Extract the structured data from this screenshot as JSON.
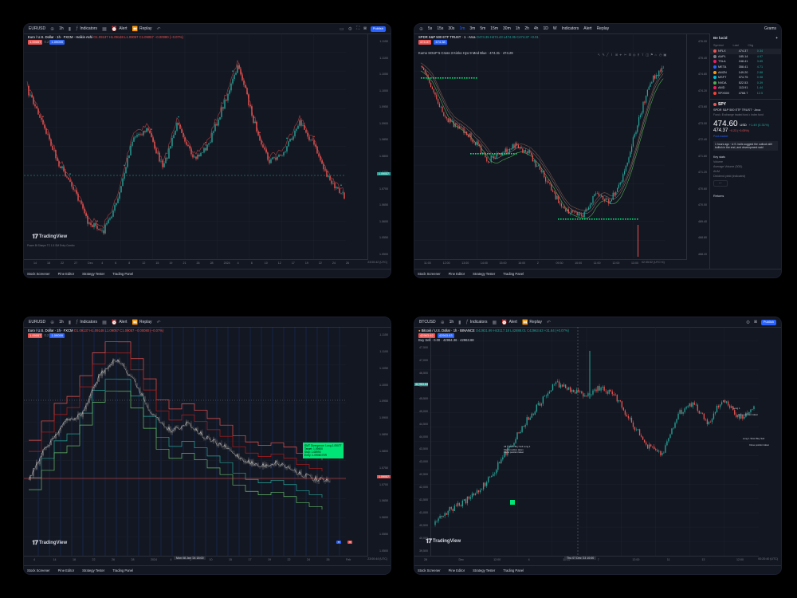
{
  "panel1": {
    "toolbar": {
      "symbol": "EURUSD",
      "interval": "1h",
      "indicators": "Indicators",
      "alert": "Alert",
      "replay": "Replay",
      "publish": "Publish"
    },
    "legend": {
      "title": "Euro / U.S. Dollar · 1h · FXCM · Heikin Ashi",
      "ohlc": "O1.09137 H1.09148 L1.09057 C1.09057 −0.00080 (−0.07%)",
      "sell": "1.09057",
      "spread": "0.2",
      "buy": "1.09059"
    },
    "price_labels": [
      "1.1150",
      "1.1100",
      "1.1050",
      "1.1000",
      "1.0950",
      "1.0900",
      "1.0850",
      "1.0800",
      "1.0750",
      "1.0700",
      "1.0650",
      "1.0600",
      "1.0550",
      "1.0500"
    ],
    "current_price": "1.09057",
    "time_labels": [
      "14",
      "18",
      "22",
      "27",
      "Dec",
      "4",
      "6",
      "8",
      "12",
      "15",
      "19",
      "21",
      "26",
      "28",
      "2024",
      "4",
      "8",
      "10",
      "12",
      "17",
      "19",
      "22",
      "24",
      "26"
    ],
    "range": [
      "1D",
      "5D",
      "1M",
      "3M",
      "6M",
      "YTD",
      "1Y",
      "5Y",
      "All"
    ],
    "status": "Power Bi Sharpe TC 1.5 SM Entry Combo",
    "clock": "23:00:42 (UTC)",
    "footer": [
      "Stock Screener",
      "Pine Editor",
      "Strategy Tester",
      "Trading Panel"
    ],
    "brand": "TradingView"
  },
  "panel2": {
    "toolbar": {
      "intervals": [
        "5s",
        "15s",
        "30s",
        "1m",
        "3m",
        "5m",
        "15m",
        "30m",
        "1h",
        "2h",
        "4h",
        "1D",
        "W"
      ],
      "indicators": "Indicators",
      "alert": "Alert",
      "replay": "Replay",
      "layout": "Grams"
    },
    "legend": {
      "title": "SPDR S&P 500 ETF TRUST · 1 · Arca",
      "ohlc": "O474.35 H474.43 L474.35 C474.37 +0.01",
      "sell": "474.37",
      "buy": "474.38"
    },
    "indicator_line": "Kumo SOUP 5 Cross 3 Kinko Hyo 9 Med Blue · 474.31 · 474.29",
    "price_labels": [
      "476.00",
      "475.40",
      "474.80",
      "474.20",
      "473.60",
      "473.00",
      "472.40",
      "471.80",
      "471.20",
      "470.60",
      "470.00",
      "469.40",
      "468.80",
      "468.20"
    ],
    "time_labels": [
      "11:00",
      "12:00",
      "13:00",
      "14:00",
      "15:00",
      "16:00",
      "2",
      "09:30",
      "10:00",
      "11:00",
      "12:00",
      "13:00"
    ],
    "range": [
      "1D",
      "5D",
      "1M",
      "3M",
      "6M",
      "YTD",
      "1Y",
      "5Y",
      "All"
    ],
    "clock": "02:35:52 (UTC+4)",
    "footer": [
      "Stock Screener",
      "Pine Editor",
      "Strategy Tester",
      "Trading Panel"
    ],
    "watchlist": {
      "title": "Be lucid",
      "columns": [
        "Symbol",
        "Last",
        "Chg"
      ],
      "rows": [
        {
          "sym": "NFLX",
          "last": "474.37",
          "chg": "0.34",
          "dot": "#ef5350",
          "dir": "up"
        },
        {
          "sym": "AAPL",
          "last": "185.14",
          "chg": "4.97",
          "dot": "#787b86",
          "dir": "up"
        },
        {
          "sym": "TSLA",
          "last": "248.41",
          "chg": "3.85",
          "dot": "#e91e63",
          "dir": "up"
        },
        {
          "sym": "META",
          "last": "358.41",
          "chg": "4.71",
          "dot": "#2962ff",
          "dir": "up"
        },
        {
          "sym": "AMZN",
          "last": "149.20",
          "chg": "2.88",
          "dot": "#ff9800",
          "dir": "up"
        },
        {
          "sym": "MSFT",
          "last": "374.75",
          "chg": "0.98",
          "dot": "#00bcd4",
          "dir": "up"
        },
        {
          "sym": "NVDA",
          "last": "522.53",
          "chg": "0.39",
          "dot": "#4caf50",
          "dir": "up"
        },
        {
          "sym": "AMD",
          "last": "113.91",
          "chg": "1.44",
          "dot": "#e91e63",
          "dir": "up"
        },
        {
          "sym": "SPX500",
          "last": "4768.7",
          "chg": "12.5",
          "dot": "#f44336",
          "dir": "up"
        }
      ],
      "detail": {
        "symbol": "SPY",
        "name": "SPDR S&P 500 ETF TRUST · Arca",
        "sub": "Fund • Exchange traded fund • Index fund",
        "price": "474.60",
        "price_unit": "USD",
        "change": "+1.49 (0.31%)",
        "post_price": "474.37",
        "post_change": "−0.23 (−0.05%)",
        "post_label": "Post-market",
        "news": "1 hours ago · U.S. bulls suggest the outlook still bullish in the end, and development said",
        "see_more": "Key stats",
        "stats": [
          [
            "Volume",
            ""
          ],
          [
            "Average Volume (30D)",
            ""
          ],
          [
            "AUM",
            ""
          ],
          [
            "Dividend yield (indicated)",
            ""
          ]
        ],
        "footer": "Returns"
      }
    }
  },
  "panel3": {
    "toolbar": {
      "symbol": "EURUSD",
      "interval": "1h",
      "indicators": "Indicators",
      "alert": "Alert",
      "replay": "Replay"
    },
    "legend": {
      "title": "Euro / U.S. Dollar · 1h · FXCM",
      "ohlc": "O1.09137 H1.09148 L1.09057 C1.09057 −0.00080 (−0.07%)",
      "sell": "1.09057",
      "spread": "0.2",
      "buy": "1.09059"
    },
    "price_labels": [
      "1.1150",
      "1.1100",
      "1.1050",
      "1.1000",
      "1.0950",
      "1.0900",
      "1.0850",
      "1.0800",
      "1.0750",
      "1.0700",
      "1.0650",
      "1.0600",
      "1.0550",
      "1.0500"
    ],
    "current_price": "1.09057",
    "callout": [
      "SMT Divergence: Long 1.09077",
      "Target: 1.09400",
      "Stop: 1.08990",
      "Entry: 1.09060 R/R"
    ],
    "date_chip": "Mon 08 Jan '24  18:00",
    "time_labels": [
      "4",
      "14",
      "18",
      "22",
      "26",
      "28",
      "2024",
      "4",
      "8",
      "10",
      "15",
      "17",
      "19",
      "22",
      "24",
      "26",
      "Feb"
    ],
    "range": [
      "1D",
      "5D",
      "1M",
      "3M",
      "6M",
      "YTD",
      "1Y",
      "5Y",
      "All"
    ],
    "clock": "23:00:44 (UTC)",
    "footer": [
      "Stock Screener",
      "Pine Editor",
      "Strategy Tester",
      "Trading Panel"
    ],
    "brand": "TradingView"
  },
  "panel4": {
    "toolbar": {
      "symbol": "BTCUSD",
      "interval": "1h",
      "indicators": "Indicators",
      "alert": "Alert",
      "replay": "Replay",
      "publish": "Publish"
    },
    "legend": {
      "title": "Bitcoin / U.S. Dollar · 1h · BINANCE",
      "ohlc": "O42931.99 H43117.18 L42888.01 C42963.63 +31.64 (+0.07%)",
      "sell": "42963.62",
      "buy": "42963.63",
      "indicator": "Buy Sell · 0.00 · 42964.36 · 42963.68"
    },
    "price_labels": [
      "48,000",
      "47,500",
      "47,000",
      "46,500",
      "46,000",
      "45,500",
      "45,000",
      "44,500",
      "44,000",
      "43,500",
      "43,000",
      "42,500",
      "42,000",
      "41,500",
      "41,000",
      "40,500",
      "40,000",
      "39,500"
    ],
    "current_price": "42,963.63",
    "annotations": [
      "All 7 Short Buy Sell Long 1 Short position taken",
      "Close position taken",
      "Long 1",
      "Close position taken",
      "Long 1 Short Buy Sell",
      "Close position taken"
    ],
    "date_chip": "Thu 07 Dec '23  10:00",
    "time_labels": [
      "28",
      "Dec",
      "12:00",
      "4",
      "12:00",
      "7",
      "12:00",
      "11",
      "13",
      "12:00"
    ],
    "range": [
      "1D",
      "5D",
      "1M",
      "3M",
      "6M",
      "YTD",
      "1Y",
      "5Y",
      "All"
    ],
    "clock": "00:20:40 (UTC)",
    "footer": [
      "Stock Screener",
      "Pine Editor",
      "Strategy Tester",
      "Trading Panel"
    ],
    "brand": "TradingView"
  },
  "colors": {
    "up": "#26a69a",
    "down": "#ef5350",
    "bg": "#131722",
    "grid": "#1e222d",
    "accent": "#2962ff",
    "green_signal": "#00e676"
  }
}
